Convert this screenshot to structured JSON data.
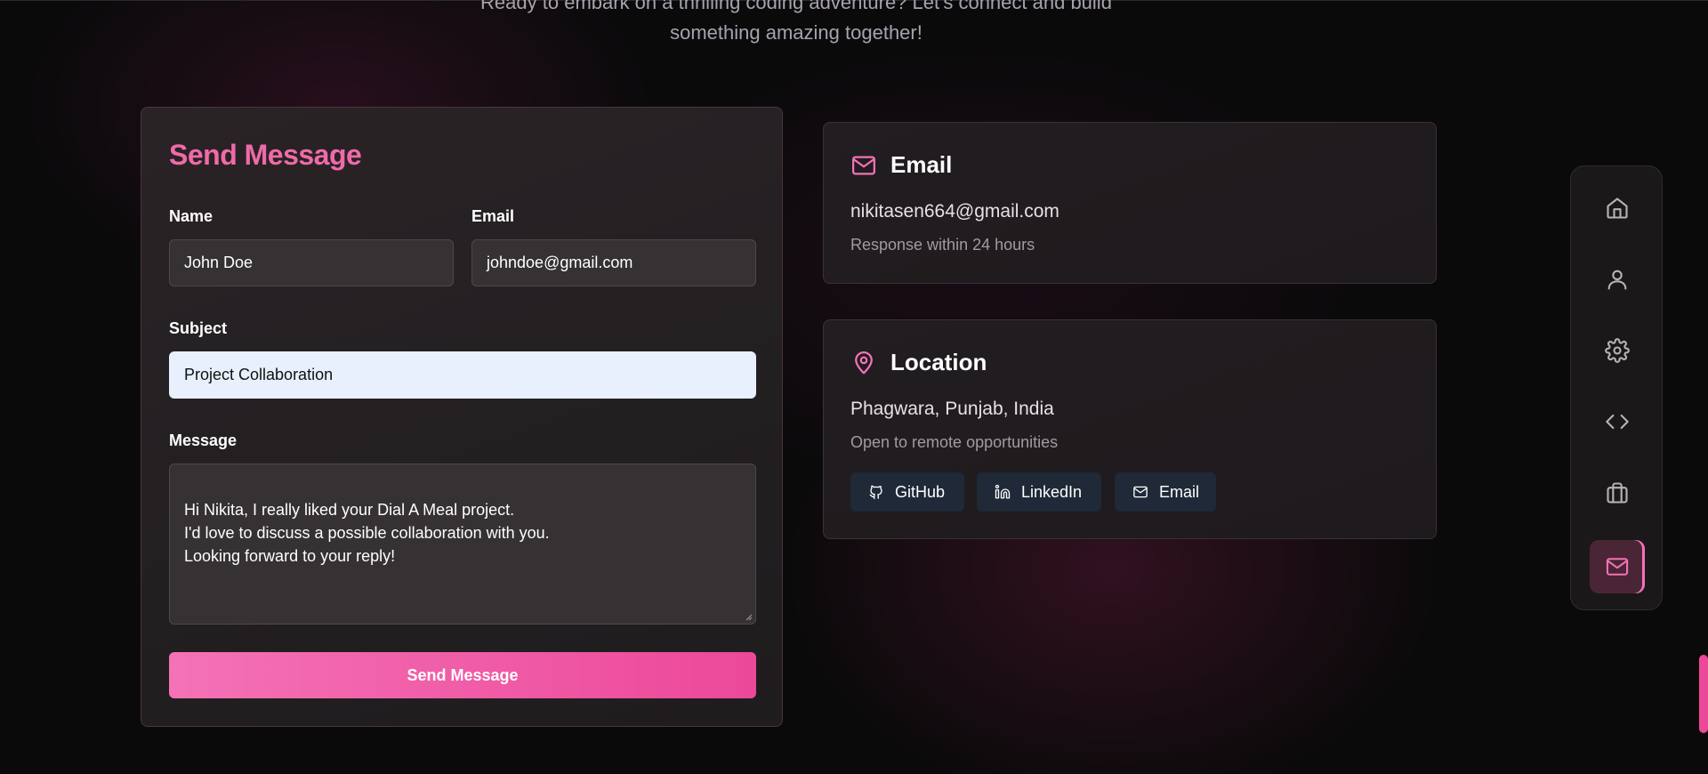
{
  "intro": {
    "line1": "Ready to embark on a thrilling coding adventure? Let's connect and build",
    "line2": "something amazing together!"
  },
  "form": {
    "title": "Send Message",
    "name_label": "Name",
    "name_value": "John Doe",
    "email_label": "Email",
    "email_value": "johndoe@gmail.com",
    "subject_label": "Subject",
    "subject_value": "Project Collaboration",
    "message_label": "Message",
    "message_value": "Hi Nikita, I really liked your Dial A Meal project.\nI'd love to discuss a possible collaboration with you.\nLooking forward to your reply!",
    "submit_label": "Send Message"
  },
  "email_card": {
    "title": "Email",
    "address": "nikitasen664@gmail.com",
    "note": "Response within 24 hours",
    "icon": "mail-icon"
  },
  "location_card": {
    "title": "Location",
    "place": "Phagwara, Punjab, India",
    "note": "Open to remote opportunities",
    "icon": "map-pin-icon",
    "links": [
      {
        "label": "GitHub",
        "icon": "github-icon"
      },
      {
        "label": "LinkedIn",
        "icon": "linkedin-icon"
      },
      {
        "label": "Email",
        "icon": "mail-icon"
      }
    ]
  },
  "side_nav": {
    "items": [
      {
        "icon": "home-icon"
      },
      {
        "icon": "user-icon"
      },
      {
        "icon": "gear-icon"
      },
      {
        "icon": "code-icon"
      },
      {
        "icon": "briefcase-icon"
      },
      {
        "icon": "mail-icon",
        "active": true
      }
    ]
  },
  "colors": {
    "accent": "#ec4899",
    "accent_light": "#f472b6",
    "background": "#0b0a0b",
    "social_button": "#1f2937"
  }
}
